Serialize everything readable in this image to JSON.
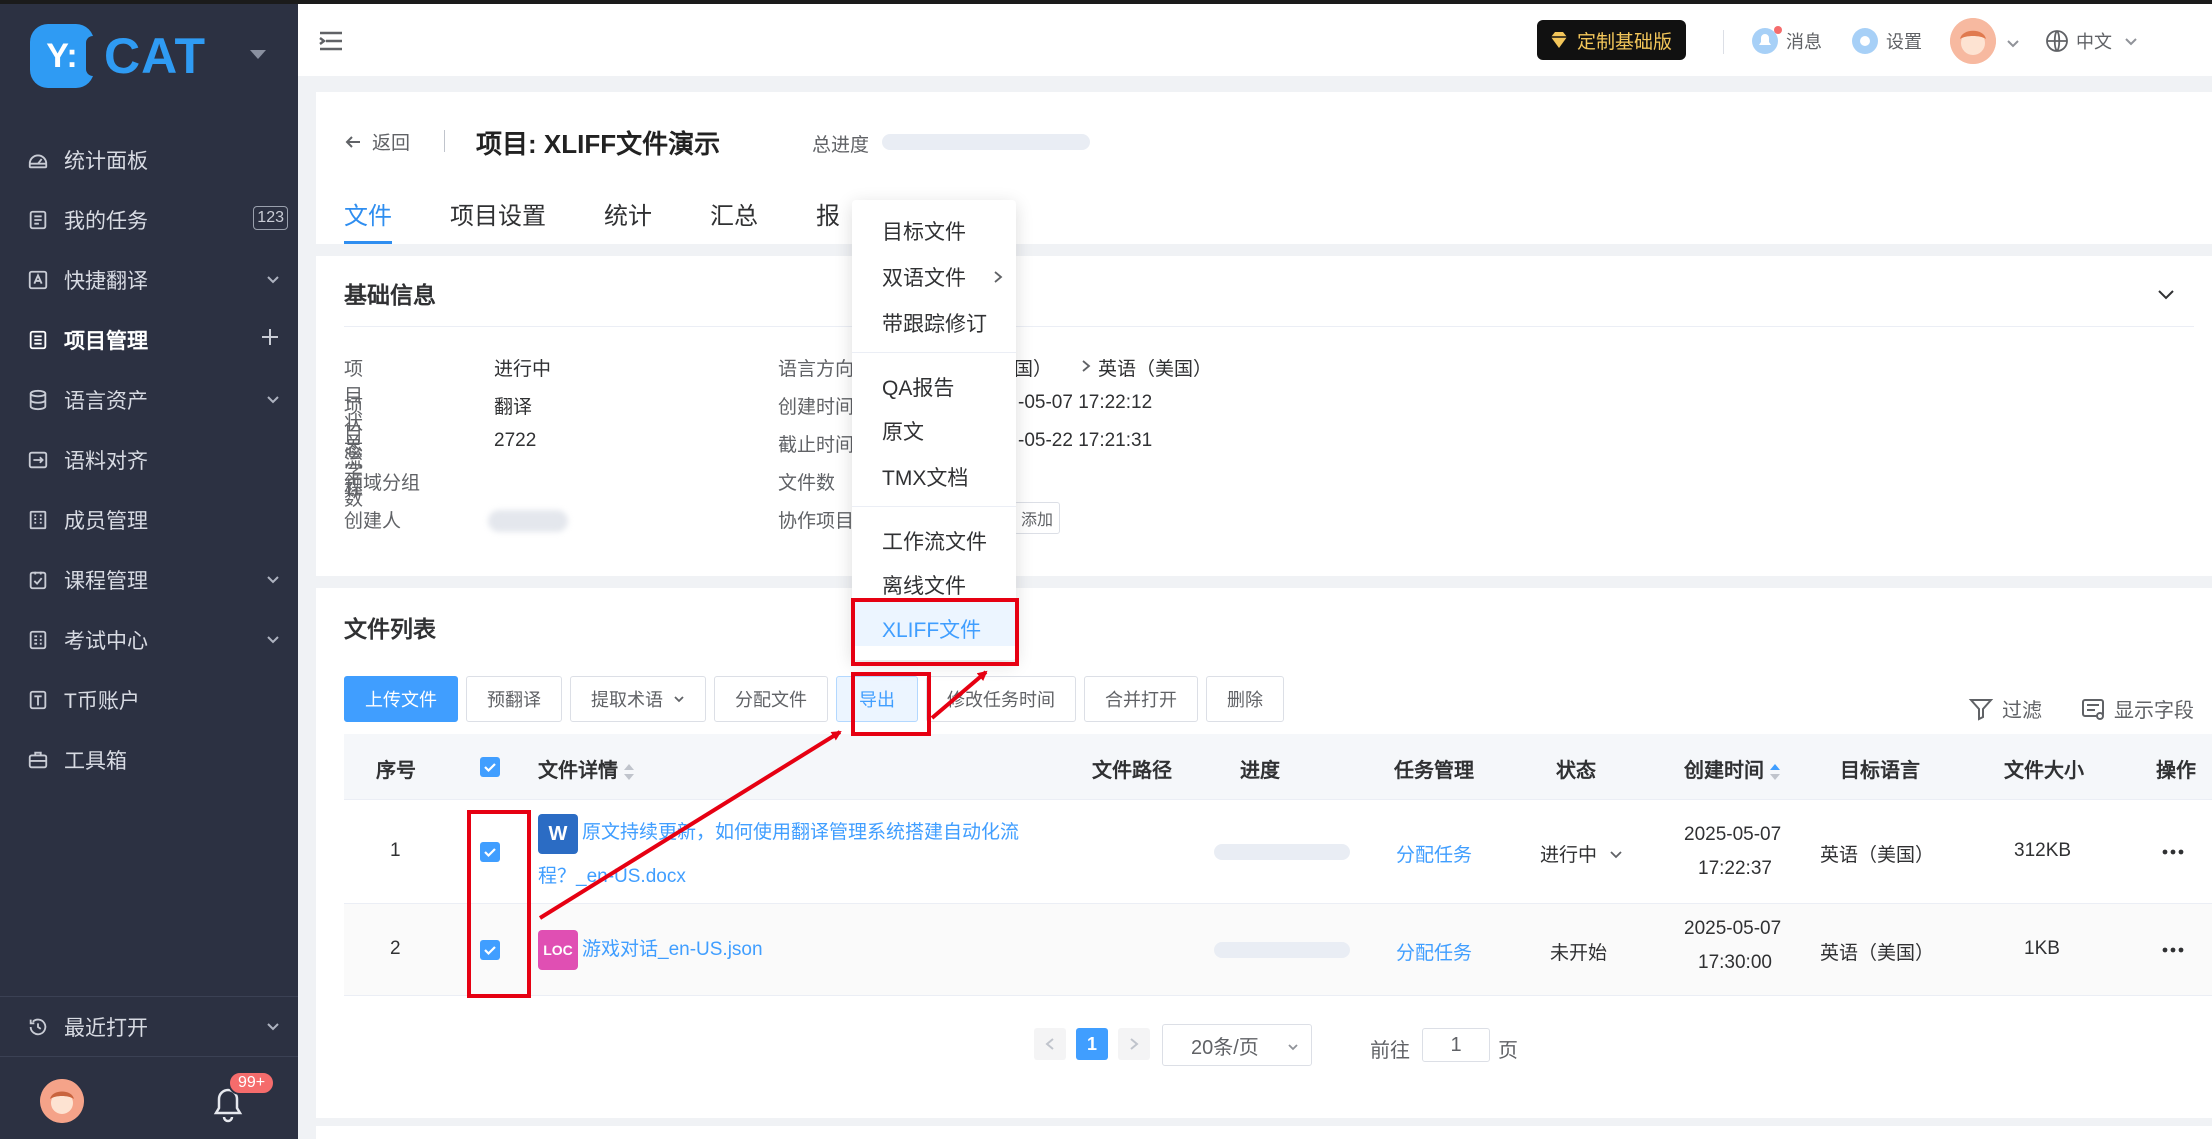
{
  "brand": {
    "logo_mark": "Y:",
    "logo_text": "CAT"
  },
  "sidebar": {
    "items": [
      {
        "label": "统计面板",
        "icon": "dashboard-icon"
      },
      {
        "label": "我的任务",
        "icon": "task-icon",
        "badge": "123"
      },
      {
        "label": "快捷翻译",
        "icon": "translate-icon"
      },
      {
        "label": "项目管理",
        "icon": "project-icon",
        "active": true
      },
      {
        "label": "语言资产",
        "icon": "database-icon"
      },
      {
        "label": "语料对齐",
        "icon": "align-icon"
      },
      {
        "label": "成员管理",
        "icon": "members-icon"
      },
      {
        "label": "课程管理",
        "icon": "course-icon"
      },
      {
        "label": "考试中心",
        "icon": "exam-icon"
      },
      {
        "label": "T币账户",
        "icon": "coin-icon"
      },
      {
        "label": "工具箱",
        "icon": "toolbox-icon"
      }
    ],
    "recent_label": "最近打开",
    "notification_badge": "99+"
  },
  "header": {
    "vip_label": "定制基础版",
    "messages_label": "消息",
    "settings_label": "设置",
    "language_label": "中文"
  },
  "project": {
    "back_label": "返回",
    "title": "项目: XLIFF文件演示",
    "progress_label": "总进度",
    "tabs": [
      "文件",
      "项目设置",
      "统计",
      "汇总",
      "报"
    ]
  },
  "info": {
    "section_title": "基础信息",
    "left": [
      {
        "label": "项目状态",
        "value": "进行中"
      },
      {
        "label": "项目流程",
        "value": "翻译"
      },
      {
        "label": "总字数",
        "value": "2722"
      },
      {
        "label": "领域分组",
        "value": ""
      },
      {
        "label": "创建人",
        "value": ""
      }
    ],
    "right": [
      {
        "label": "语言方向",
        "value": "（中国）",
        "target": "英语（美国）"
      },
      {
        "label": "创建时间",
        "value": "-05-07 17:22:12"
      },
      {
        "label": "截止时间",
        "value": "-05-22 17:21:31"
      },
      {
        "label": "文件数",
        "value": ""
      },
      {
        "label": "协作项目",
        "value": "添加"
      }
    ]
  },
  "files": {
    "section_title": "文件列表",
    "toolbar": {
      "upload": "上传文件",
      "pretranslate": "预翻译",
      "extract_terms": "提取术语",
      "assign_files": "分配文件",
      "export": "导出",
      "modify_time": "修改任务时间",
      "merge_open": "合并打开",
      "delete": "删除"
    },
    "filter_label": "过滤",
    "show_fields_label": "显示字段",
    "columns": [
      "序号",
      "文件详情",
      "文件路径",
      "进度",
      "任务管理",
      "状态",
      "创建时间",
      "目标语言",
      "文件大小",
      "操作"
    ],
    "rows": [
      {
        "index": "1",
        "icon_label": "W",
        "name_line1": "原文持续更新，如何使用翻译管理系统搭建自动化流",
        "name_line2": "程？_en-US.docx",
        "task": "分配任务",
        "status": "进行中",
        "created_date": "2025-05-07",
        "created_time": "17:22:37",
        "target": "英语（美国）",
        "size": "312KB"
      },
      {
        "index": "2",
        "icon_label": "LOC",
        "name_line1": "游戏对话_en-US.json",
        "name_line2": "",
        "task": "分配任务",
        "status": "未开始",
        "created_date": "2025-05-07",
        "created_time": "17:30:00",
        "target": "英语（美国）",
        "size": "1KB"
      }
    ],
    "pagination": {
      "current": "1",
      "page_size": "20条/页",
      "goto_prefix": "前往",
      "goto_value": "1",
      "goto_suffix": "页"
    }
  },
  "export_menu": {
    "items": [
      "目标文件",
      "双语文件",
      "带跟踪修订",
      "QA报告",
      "原文",
      "TMX文档",
      "工作流文件",
      "离线文件",
      "XLIFF文件"
    ],
    "highlighted": "XLIFF文件"
  },
  "colors": {
    "sidebar_bg": "#2c3142",
    "primary": "#409eff",
    "annotation_red": "#e60012",
    "vip_gold": "#f3c65a"
  }
}
